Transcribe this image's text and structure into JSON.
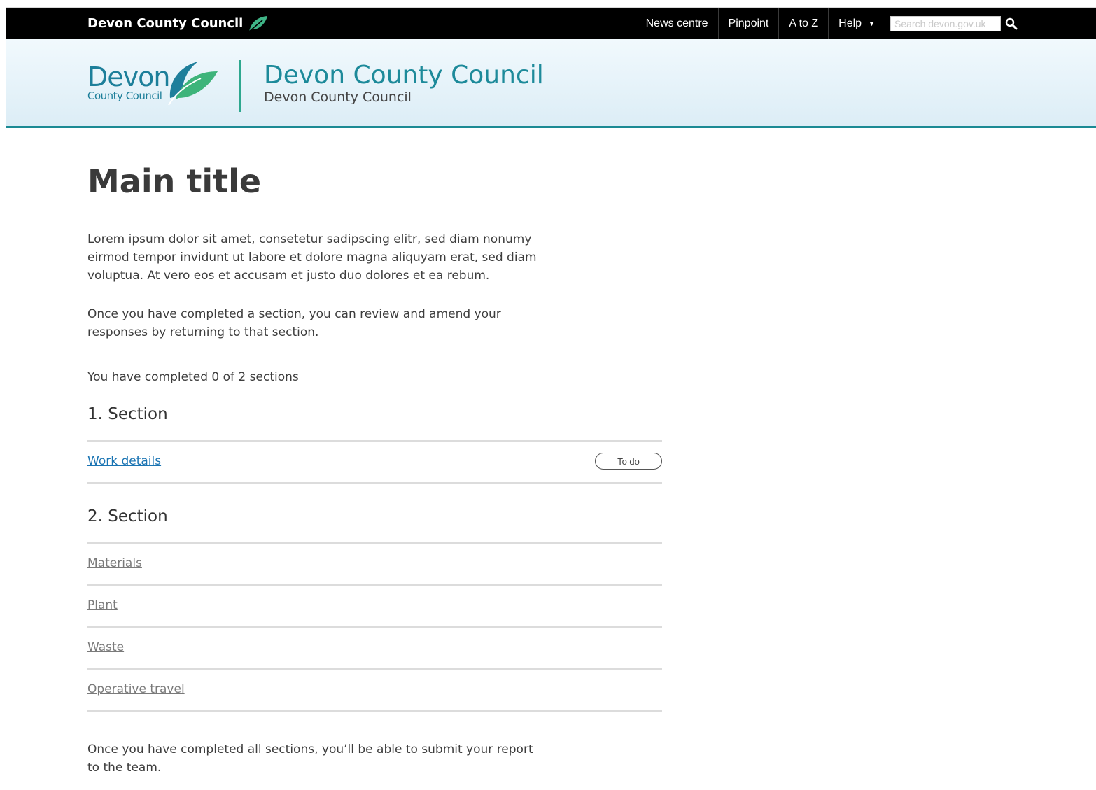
{
  "topbar": {
    "brand": "Devon County Council",
    "nav": [
      {
        "label": "News centre"
      },
      {
        "label": "Pinpoint"
      },
      {
        "label": "A to Z"
      },
      {
        "label": "Help"
      }
    ],
    "search": {
      "placeholder": "Search devon.gov.uk",
      "value": ""
    }
  },
  "header": {
    "logo_word": "Devon",
    "logo_sub": "County Council",
    "title": "Devon County Council",
    "subtitle": "Devon County Council"
  },
  "main": {
    "title": "Main title",
    "intro": "Lorem ipsum dolor sit amet, consetetur sadipscing elitr, sed diam nonumy eirmod tempor invidunt ut labore et dolore magna aliquyam erat, sed diam voluptua. At vero eos et accusam et justo duo dolores et ea rebum.",
    "review_note": "Once you have completed a section, you can review and amend your responses by returning to that section.",
    "progress": "You have completed 0 of 2 sections",
    "sections": [
      {
        "heading": "1. Section",
        "tasks": [
          {
            "label": "Work details",
            "status": "To do"
          }
        ]
      },
      {
        "heading": "2. Section",
        "tasks": [
          {
            "label": "Materials"
          },
          {
            "label": "Plant"
          },
          {
            "label": "Waste"
          },
          {
            "label": "Operative travel"
          }
        ]
      }
    ],
    "footer_note": "Once you have completed all sections, you’ll be able to submit your report to the team."
  },
  "colors": {
    "brand_teal": "#1d8a9a",
    "leaf_green": "#2ea88f",
    "link_blue": "#1a74b3"
  }
}
